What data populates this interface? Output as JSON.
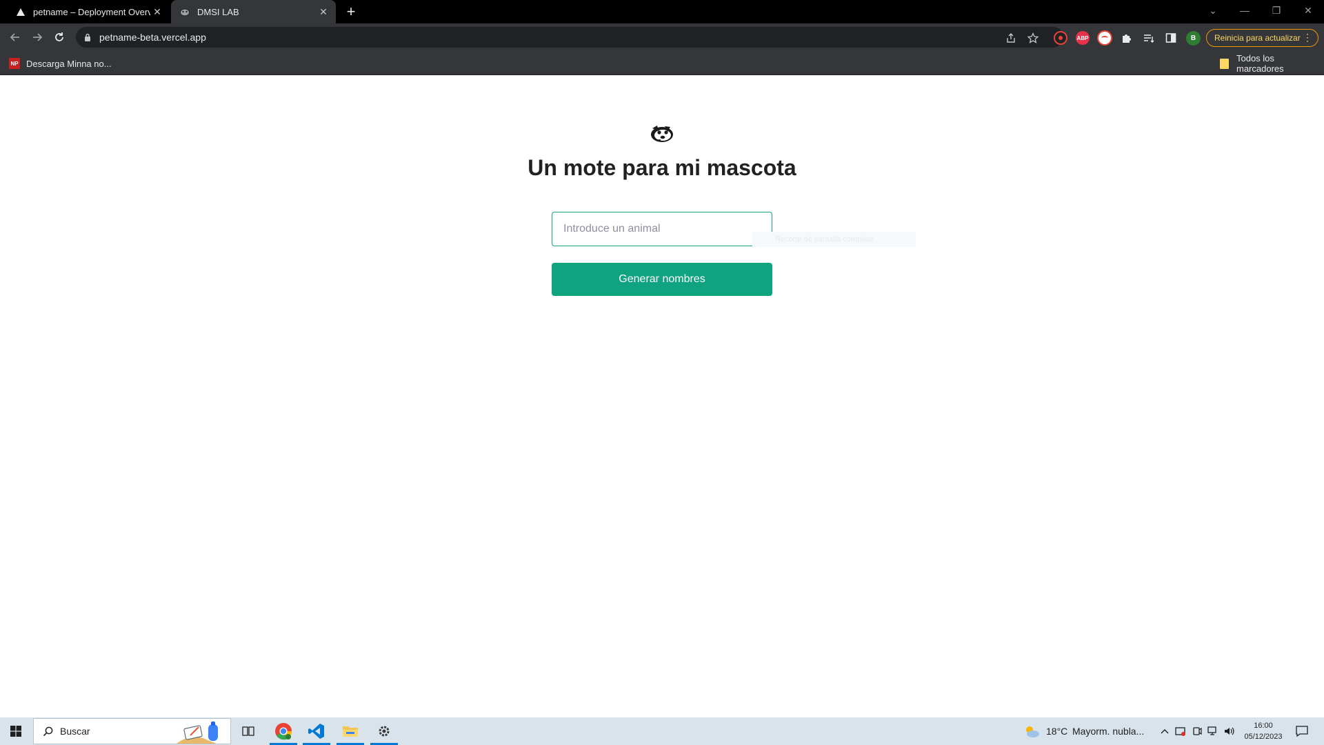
{
  "browser": {
    "tabs": [
      {
        "title": "petname – Deployment Overvie",
        "favicon": "vercel-triangle-icon",
        "active": false
      },
      {
        "title": "DMSI LAB",
        "favicon": "dog-icon",
        "active": true
      }
    ],
    "new_tab_label": "+",
    "url": "petname-beta.vercel.app",
    "update_button_label": "Reinicia para actualizar",
    "extensions": [
      {
        "name": "record-extension-icon",
        "label": ""
      },
      {
        "name": "adblock-icon",
        "label": "ABP"
      },
      {
        "name": "extension-badge-icon",
        "label": ""
      },
      {
        "name": "puzzle-icon",
        "label": ""
      }
    ],
    "profile_initial": "B",
    "bookmarks": [
      {
        "label": "Descarga Minna no...",
        "icon": "np-icon",
        "icon_text": "NP"
      }
    ],
    "all_bookmarks_label": "Todos los marcadores"
  },
  "page": {
    "heading": "Un mote para mi mascota",
    "input_placeholder": "Introduce un animal",
    "submit_label": "Generar nombres",
    "ghost_tooltip": "Recorte de pantalla completa",
    "accent_color": "#10a37f"
  },
  "taskbar": {
    "search_placeholder": "Buscar",
    "weather_temp": "18°C",
    "weather_desc": "Mayorm. nubla...",
    "time": "16:00",
    "date": "05/12/2023"
  }
}
